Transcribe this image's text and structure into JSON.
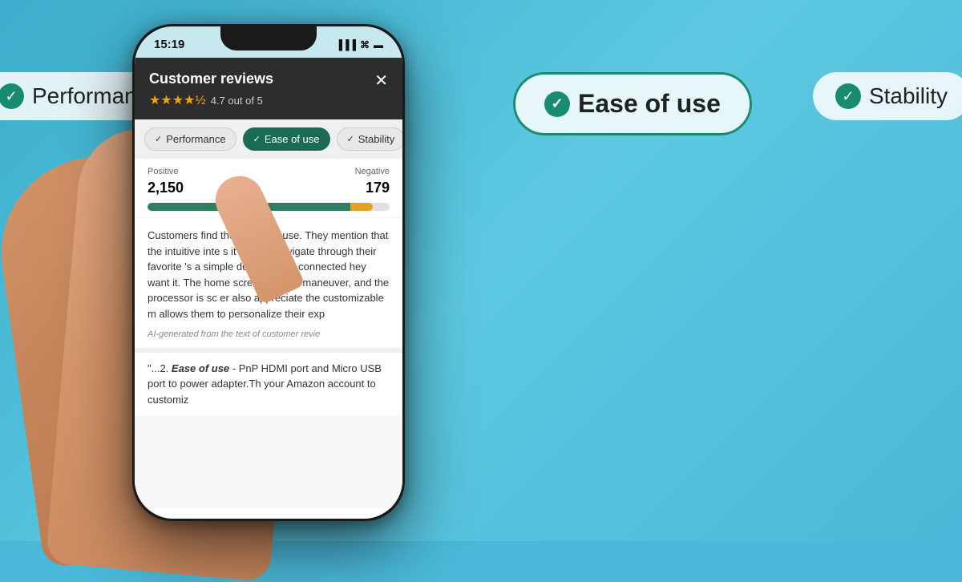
{
  "background": {
    "color": "#4ab8d8"
  },
  "bg_tags": [
    {
      "id": "performance",
      "label": "Performance",
      "active": false,
      "position": "top-left"
    },
    {
      "id": "ease-of-use",
      "label": "Ease of use",
      "active": true,
      "position": "top-center-right"
    },
    {
      "id": "stability",
      "label": "Stability",
      "active": false,
      "position": "top-right"
    }
  ],
  "phone": {
    "status_bar": {
      "time": "15:19",
      "signal": "▐▐▐",
      "wifi": "⬡",
      "battery": "▬"
    },
    "reviews_modal": {
      "title": "Customer reviews",
      "rating_stars": "★★★★½",
      "rating_text": "4.7 out of 5",
      "close_button": "✕",
      "filter_tags": [
        {
          "label": "Performance",
          "active": false
        },
        {
          "label": "Ease of use",
          "active": true
        },
        {
          "label": "Stability",
          "active": false
        }
      ],
      "stats": {
        "positive_label": "Positive",
        "negative_label": "Negative",
        "positive_count": "2,150",
        "negative_count": "179",
        "bar_positive_pct": 92
      },
      "summary_text": "Customers find the digital de use. They mention that the intuitive inte s it easy to navigate through their favorite 's a simple device to get connected hey want it. The home screen display maneuver, and the processor is sc er also appreciate the customizable m allows them to personalize their exp",
      "ai_label": "AI-generated from the text of customer revie",
      "quote_text": "\"...2. Ease of use - PnP HDMI port and Micro USB port to power adapter.Th your Amazon account to customiz"
    }
  }
}
